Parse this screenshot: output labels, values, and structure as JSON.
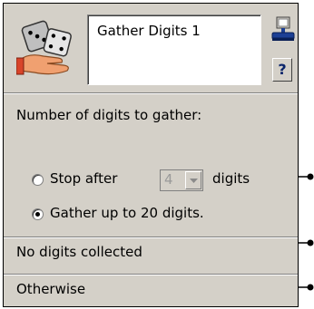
{
  "node": {
    "title": "Gather Digits 1",
    "icons": {
      "main": "dice-hand-icon",
      "edit": "edit-stamp-icon",
      "help": "help-icon"
    },
    "help_label": "?"
  },
  "digits": {
    "heading": "Number of digits to gather:",
    "option_stop_prefix": "Stop after",
    "option_stop_suffix": "digits",
    "stop_count": "4",
    "option_gather": "Gather up to 20 digits.",
    "selected": "gather"
  },
  "outputs": {
    "no_digits": "No digits collected",
    "otherwise": "Otherwise"
  }
}
